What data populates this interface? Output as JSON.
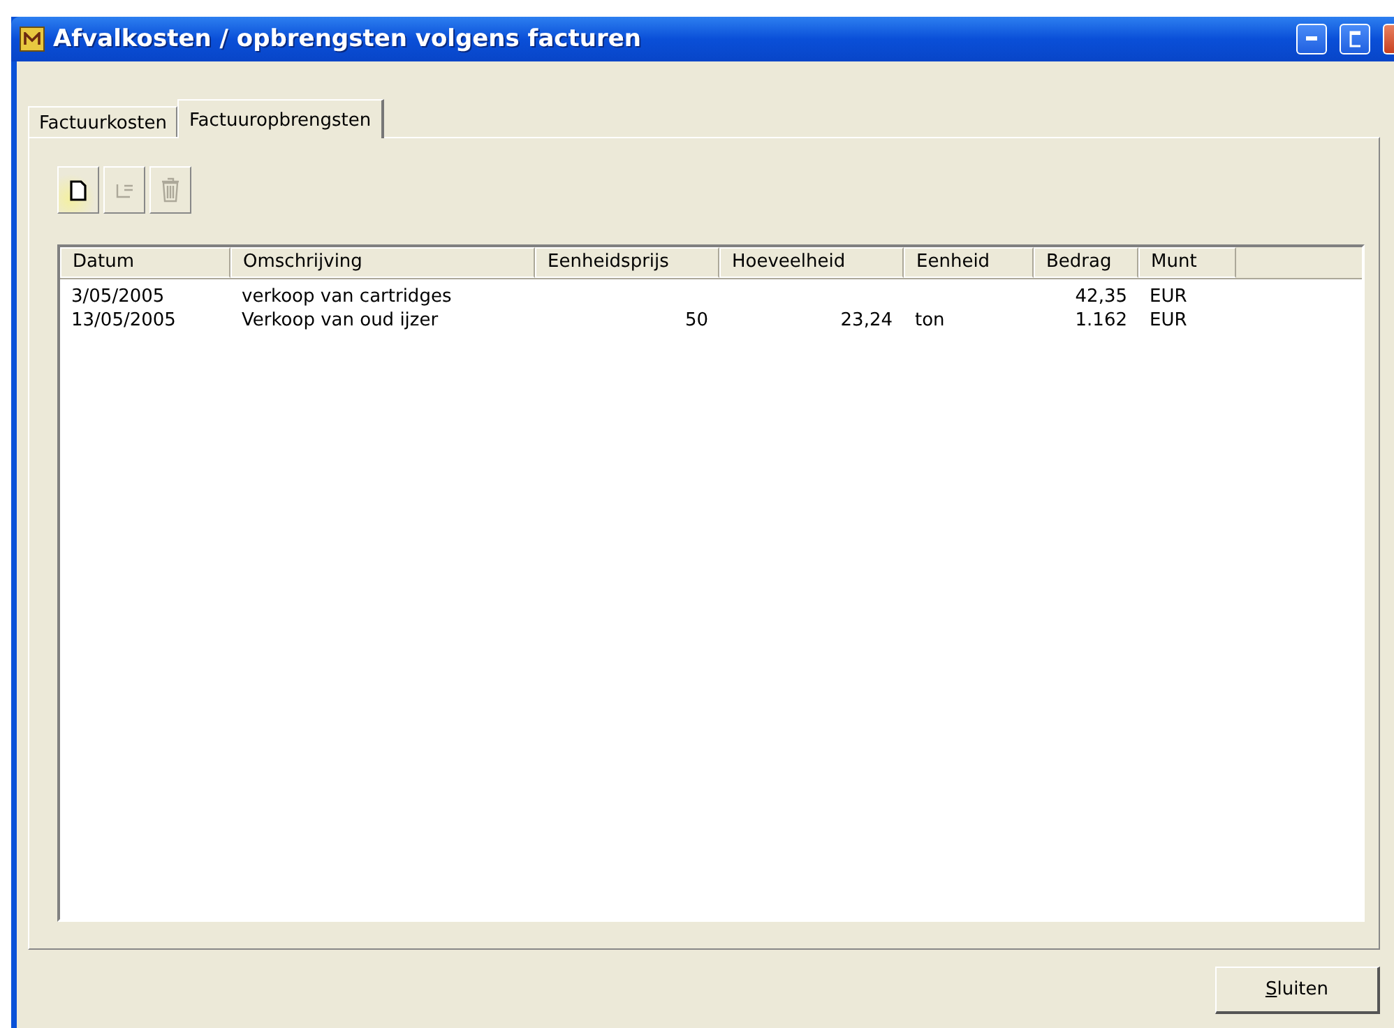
{
  "window": {
    "title": "Afvalkosten / opbrengsten volgens facturen"
  },
  "tabs": [
    {
      "label": "Factuurkosten",
      "selected": false
    },
    {
      "label": "Factuuropbrengsten",
      "selected": true
    }
  ],
  "toolbar": [
    {
      "kind": "new",
      "disabled": false
    },
    {
      "kind": "edit",
      "disabled": true
    },
    {
      "kind": "delete",
      "disabled": true
    }
  ],
  "table": {
    "columns": [
      "Datum",
      "Omschrijving",
      "Eenheidsprijs",
      "Hoeveelheid",
      "Eenheid",
      "Bedrag",
      "Munt"
    ],
    "rows": [
      {
        "cells": [
          "3/05/2005",
          "verkoop van cartridges",
          null,
          null,
          null,
          "42,35",
          "EUR"
        ]
      },
      {
        "cells": [
          "13/05/2005",
          "Verkoop van oud ijzer",
          "50",
          "23,24",
          "ton",
          "1.162",
          "EUR"
        ]
      }
    ]
  },
  "buttons": [
    {
      "label": "Sluiten",
      "mnemonic_underlined": true
    }
  ]
}
